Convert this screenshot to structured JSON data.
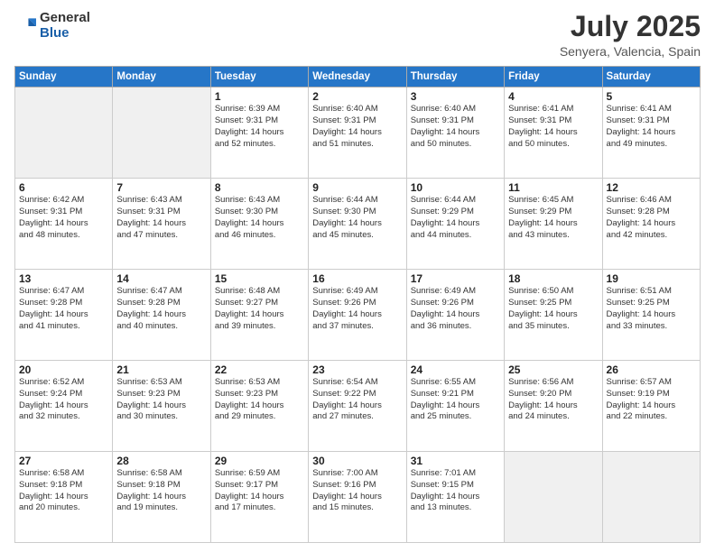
{
  "header": {
    "logo_general": "General",
    "logo_blue": "Blue",
    "main_title": "July 2025",
    "subtitle": "Senyera, Valencia, Spain"
  },
  "calendar": {
    "days_of_week": [
      "Sunday",
      "Monday",
      "Tuesday",
      "Wednesday",
      "Thursday",
      "Friday",
      "Saturday"
    ],
    "weeks": [
      [
        {
          "day": "",
          "empty": true
        },
        {
          "day": "",
          "empty": true
        },
        {
          "day": "1",
          "sunrise": "6:39 AM",
          "sunset": "9:31 PM",
          "daylight": "14 hours and 52 minutes."
        },
        {
          "day": "2",
          "sunrise": "6:40 AM",
          "sunset": "9:31 PM",
          "daylight": "14 hours and 51 minutes."
        },
        {
          "day": "3",
          "sunrise": "6:40 AM",
          "sunset": "9:31 PM",
          "daylight": "14 hours and 50 minutes."
        },
        {
          "day": "4",
          "sunrise": "6:41 AM",
          "sunset": "9:31 PM",
          "daylight": "14 hours and 50 minutes."
        },
        {
          "day": "5",
          "sunrise": "6:41 AM",
          "sunset": "9:31 PM",
          "daylight": "14 hours and 49 minutes."
        }
      ],
      [
        {
          "day": "6",
          "sunrise": "6:42 AM",
          "sunset": "9:31 PM",
          "daylight": "14 hours and 48 minutes."
        },
        {
          "day": "7",
          "sunrise": "6:43 AM",
          "sunset": "9:31 PM",
          "daylight": "14 hours and 47 minutes."
        },
        {
          "day": "8",
          "sunrise": "6:43 AM",
          "sunset": "9:30 PM",
          "daylight": "14 hours and 46 minutes."
        },
        {
          "day": "9",
          "sunrise": "6:44 AM",
          "sunset": "9:30 PM",
          "daylight": "14 hours and 45 minutes."
        },
        {
          "day": "10",
          "sunrise": "6:44 AM",
          "sunset": "9:29 PM",
          "daylight": "14 hours and 44 minutes."
        },
        {
          "day": "11",
          "sunrise": "6:45 AM",
          "sunset": "9:29 PM",
          "daylight": "14 hours and 43 minutes."
        },
        {
          "day": "12",
          "sunrise": "6:46 AM",
          "sunset": "9:28 PM",
          "daylight": "14 hours and 42 minutes."
        }
      ],
      [
        {
          "day": "13",
          "sunrise": "6:47 AM",
          "sunset": "9:28 PM",
          "daylight": "14 hours and 41 minutes."
        },
        {
          "day": "14",
          "sunrise": "6:47 AM",
          "sunset": "9:28 PM",
          "daylight": "14 hours and 40 minutes."
        },
        {
          "day": "15",
          "sunrise": "6:48 AM",
          "sunset": "9:27 PM",
          "daylight": "14 hours and 39 minutes."
        },
        {
          "day": "16",
          "sunrise": "6:49 AM",
          "sunset": "9:26 PM",
          "daylight": "14 hours and 37 minutes."
        },
        {
          "day": "17",
          "sunrise": "6:49 AM",
          "sunset": "9:26 PM",
          "daylight": "14 hours and 36 minutes."
        },
        {
          "day": "18",
          "sunrise": "6:50 AM",
          "sunset": "9:25 PM",
          "daylight": "14 hours and 35 minutes."
        },
        {
          "day": "19",
          "sunrise": "6:51 AM",
          "sunset": "9:25 PM",
          "daylight": "14 hours and 33 minutes."
        }
      ],
      [
        {
          "day": "20",
          "sunrise": "6:52 AM",
          "sunset": "9:24 PM",
          "daylight": "14 hours and 32 minutes."
        },
        {
          "day": "21",
          "sunrise": "6:53 AM",
          "sunset": "9:23 PM",
          "daylight": "14 hours and 30 minutes."
        },
        {
          "day": "22",
          "sunrise": "6:53 AM",
          "sunset": "9:23 PM",
          "daylight": "14 hours and 29 minutes."
        },
        {
          "day": "23",
          "sunrise": "6:54 AM",
          "sunset": "9:22 PM",
          "daylight": "14 hours and 27 minutes."
        },
        {
          "day": "24",
          "sunrise": "6:55 AM",
          "sunset": "9:21 PM",
          "daylight": "14 hours and 25 minutes."
        },
        {
          "day": "25",
          "sunrise": "6:56 AM",
          "sunset": "9:20 PM",
          "daylight": "14 hours and 24 minutes."
        },
        {
          "day": "26",
          "sunrise": "6:57 AM",
          "sunset": "9:19 PM",
          "daylight": "14 hours and 22 minutes."
        }
      ],
      [
        {
          "day": "27",
          "sunrise": "6:58 AM",
          "sunset": "9:18 PM",
          "daylight": "14 hours and 20 minutes."
        },
        {
          "day": "28",
          "sunrise": "6:58 AM",
          "sunset": "9:18 PM",
          "daylight": "14 hours and 19 minutes."
        },
        {
          "day": "29",
          "sunrise": "6:59 AM",
          "sunset": "9:17 PM",
          "daylight": "14 hours and 17 minutes."
        },
        {
          "day": "30",
          "sunrise": "7:00 AM",
          "sunset": "9:16 PM",
          "daylight": "14 hours and 15 minutes."
        },
        {
          "day": "31",
          "sunrise": "7:01 AM",
          "sunset": "9:15 PM",
          "daylight": "14 hours and 13 minutes."
        },
        {
          "day": "",
          "empty": true
        },
        {
          "day": "",
          "empty": true
        }
      ]
    ]
  }
}
